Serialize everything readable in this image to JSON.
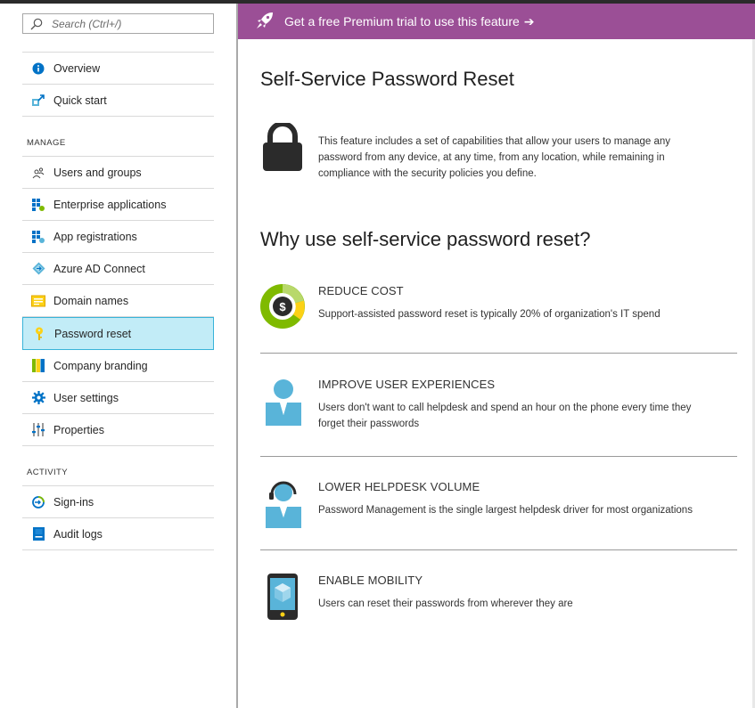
{
  "search": {
    "placeholder": "Search (Ctrl+/)"
  },
  "sidebar": {
    "top_items": [
      {
        "label": "Overview",
        "icon": "info-icon"
      },
      {
        "label": "Quick start",
        "icon": "quick-start-icon"
      }
    ],
    "manage_label": "MANAGE",
    "manage_items": [
      {
        "label": "Users and groups",
        "icon": "users-icon"
      },
      {
        "label": "Enterprise applications",
        "icon": "enterprise-apps-icon"
      },
      {
        "label": "App registrations",
        "icon": "app-registrations-icon"
      },
      {
        "label": "Azure AD Connect",
        "icon": "azure-ad-connect-icon"
      },
      {
        "label": "Domain names",
        "icon": "domain-names-icon"
      },
      {
        "label": "Password reset",
        "icon": "key-icon",
        "active": true
      },
      {
        "label": "Company branding",
        "icon": "branding-icon"
      },
      {
        "label": "User settings",
        "icon": "gear-icon"
      },
      {
        "label": "Properties",
        "icon": "properties-icon"
      }
    ],
    "activity_label": "ACTIVITY",
    "activity_items": [
      {
        "label": "Sign-ins",
        "icon": "sign-ins-icon"
      },
      {
        "label": "Audit logs",
        "icon": "audit-logs-icon"
      }
    ]
  },
  "banner": {
    "text": "Get a free Premium trial to use this feature",
    "color": "#9b4f96"
  },
  "main": {
    "title": "Self-Service Password Reset",
    "intro": "This feature includes a set of capabilities that allow your users to manage any password from any device, at any time, from any location, while remaining in compliance with the security policies you define.",
    "why_title": "Why use self-service password reset?",
    "features": [
      {
        "heading": "REDUCE COST",
        "desc": "Support-assisted password reset is typically 20% of organization's IT spend",
        "icon": "cost-donut-icon"
      },
      {
        "heading": "IMPROVE USER EXPERIENCES",
        "desc": "Users don't want to call helpdesk and spend an hour on the phone every time they forget their passwords",
        "icon": "user-icon"
      },
      {
        "heading": "LOWER HELPDESK VOLUME",
        "desc": "Password Management is the single largest helpdesk driver for most organizations",
        "icon": "helpdesk-user-icon"
      },
      {
        "heading": "ENABLE MOBILITY",
        "desc": "Users can reset their passwords from wherever they are",
        "icon": "mobile-phone-icon"
      }
    ]
  },
  "colors": {
    "accent": "#38b3d9",
    "active_bg": "#c2ecf7",
    "azure_blue": "#0072c6",
    "banner": "#9b4f96"
  }
}
